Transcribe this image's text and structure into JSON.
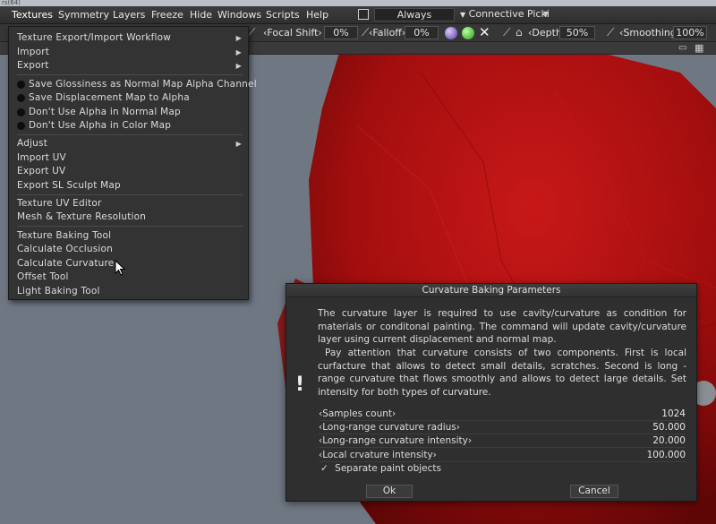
{
  "titlebar": {
    "text": "rs(64)"
  },
  "menubar": {
    "items": [
      "Textures",
      "Symmetry",
      "Layers",
      "Freeze",
      "Hide",
      "Windows",
      "Scripts",
      "Help"
    ],
    "mode_value": "Always",
    "connective_value": "Connective Picki"
  },
  "toolbar": {
    "focal_shift_label": "Focal Shift",
    "focal_shift_value": "0%",
    "falloff_label": "Falloff",
    "falloff_value": "0%",
    "depth_label": "Depth",
    "depth_value": "50%",
    "smoothing_label": "Smoothing",
    "smoothing_value": "100%"
  },
  "textures_menu": {
    "group1": [
      "Texture Export/Import Workflow",
      "Import",
      "Export"
    ],
    "group2": [
      "Save Glossiness as Normal Map Alpha Channel",
      "Save Displacement Map to Alpha",
      "Don't Use Alpha in Normal Map",
      "Don't Use Alpha in Color Map"
    ],
    "group3": [
      "Adjust",
      "Import UV",
      "Export UV",
      "Export SL Sculpt Map"
    ],
    "group4": [
      "Texture UV Editor",
      "Mesh & Texture Resolution"
    ],
    "group5": [
      "Texture Baking Tool",
      "Calculate Occlusion",
      "Calculate Curvature",
      "Offset Tool",
      "Light Baking Tool"
    ]
  },
  "dialog": {
    "title": "Curvature Baking Parameters",
    "paragraph1": "The curvature layer is required to use cavity/curvature as condition for materials or conditonal painting. The command will update cavity/curvature layer using current displacement and normal map.",
    "paragraph2": "Pay attention that curvature consists of two components. First is local curfacture that allows to detect small details, scratches. Second is long - range curvature that flows smoothly and allows to detect large details. Set intensity for both types of curvature.",
    "params": [
      {
        "label": "Samples count",
        "value": "1024"
      },
      {
        "label": "Long-range curvature radius",
        "value": "50.000"
      },
      {
        "label": "Long-range curvature intensity",
        "value": "20.000"
      },
      {
        "label": "Local crvature intensity",
        "value": "100.000"
      }
    ],
    "separate_label": "Separate paint objects",
    "ok_label": "Ok",
    "cancel_label": "Cancel"
  },
  "colors": {
    "model_red": "#b01010",
    "background": "#6f7783",
    "panel": "#333333"
  }
}
